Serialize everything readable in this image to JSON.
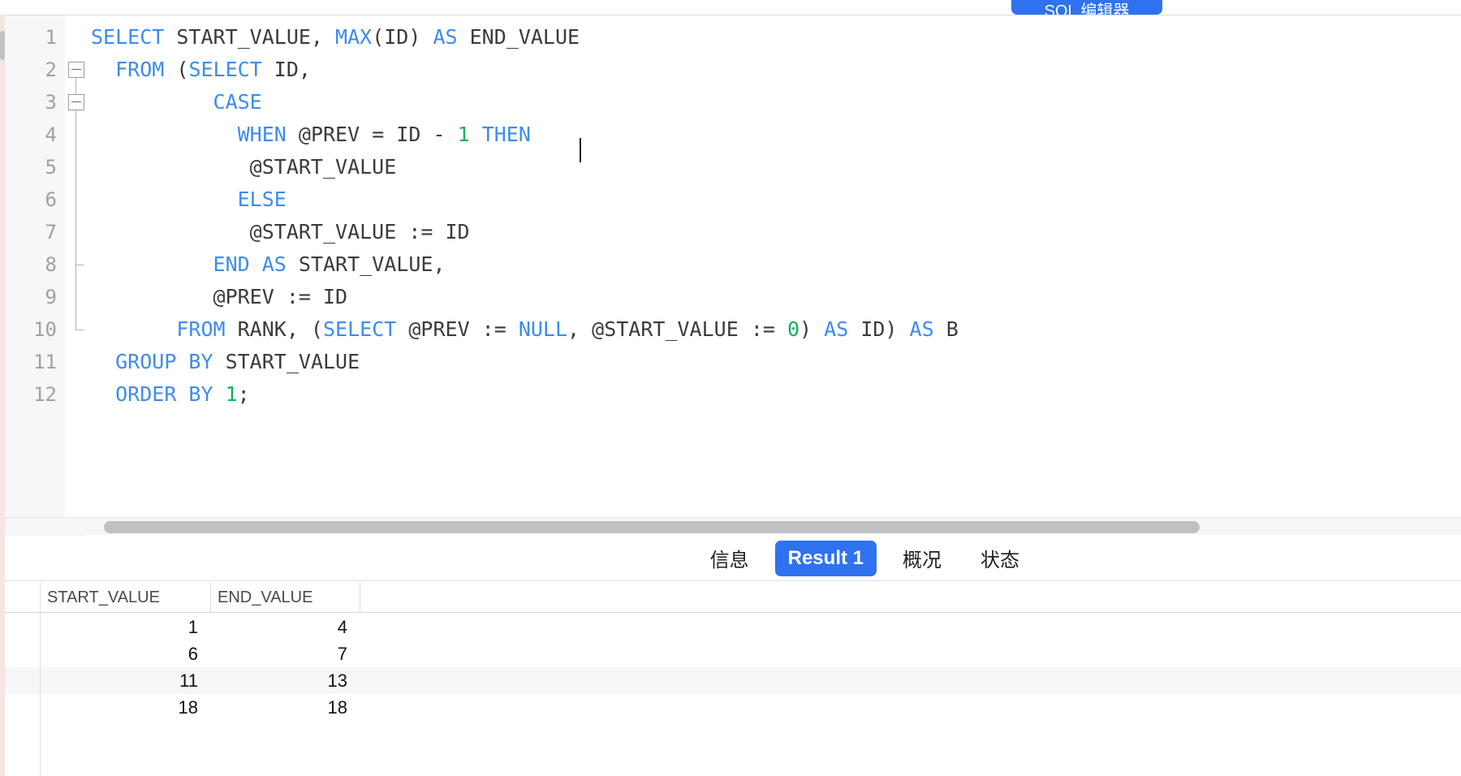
{
  "toolbar": {
    "sql_editor_button": "SQL 编辑器",
    "accent_color": "#2f72f0"
  },
  "editor": {
    "language": "sql",
    "caret_line": 4,
    "caret_after_text": "THEN",
    "lines": [
      {
        "n": "1",
        "tokens": [
          {
            "t": "SELECT",
            "c": "kw"
          },
          {
            "t": " START_VALUE, ",
            "c": "pl"
          },
          {
            "t": "MAX",
            "c": "kw"
          },
          {
            "t": "(ID) ",
            "c": "pl"
          },
          {
            "t": "AS",
            "c": "kw"
          },
          {
            "t": " END_VALUE",
            "c": "pl"
          }
        ]
      },
      {
        "n": "2",
        "tokens": [
          {
            "t": "  ",
            "c": "pl"
          },
          {
            "t": "FROM",
            "c": "kw"
          },
          {
            "t": " (",
            "c": "pl"
          },
          {
            "t": "SELECT",
            "c": "kw"
          },
          {
            "t": " ID,",
            "c": "pl"
          }
        ]
      },
      {
        "n": "3",
        "tokens": [
          {
            "t": "          ",
            "c": "pl"
          },
          {
            "t": "CASE",
            "c": "kw"
          }
        ]
      },
      {
        "n": "4",
        "tokens": [
          {
            "t": "            ",
            "c": "pl"
          },
          {
            "t": "WHEN",
            "c": "kw"
          },
          {
            "t": " @PREV = ID - ",
            "c": "pl"
          },
          {
            "t": "1",
            "c": "num"
          },
          {
            "t": " ",
            "c": "pl"
          },
          {
            "t": "THEN",
            "c": "kw"
          }
        ]
      },
      {
        "n": "5",
        "tokens": [
          {
            "t": "             @START_VALUE",
            "c": "pl"
          }
        ]
      },
      {
        "n": "6",
        "tokens": [
          {
            "t": "            ",
            "c": "pl"
          },
          {
            "t": "ELSE",
            "c": "kw"
          }
        ]
      },
      {
        "n": "7",
        "tokens": [
          {
            "t": "             @START_VALUE := ID",
            "c": "pl"
          }
        ]
      },
      {
        "n": "8",
        "tokens": [
          {
            "t": "          ",
            "c": "pl"
          },
          {
            "t": "END",
            "c": "kw"
          },
          {
            "t": " ",
            "c": "pl"
          },
          {
            "t": "AS",
            "c": "kw"
          },
          {
            "t": " START_VALUE,",
            "c": "pl"
          }
        ]
      },
      {
        "n": "9",
        "tokens": [
          {
            "t": "          @PREV := ID",
            "c": "pl"
          }
        ]
      },
      {
        "n": "10",
        "tokens": [
          {
            "t": "       ",
            "c": "pl"
          },
          {
            "t": "FROM",
            "c": "kw"
          },
          {
            "t": " RANK, (",
            "c": "pl"
          },
          {
            "t": "SELECT",
            "c": "kw"
          },
          {
            "t": " @PREV := ",
            "c": "pl"
          },
          {
            "t": "NULL",
            "c": "kw"
          },
          {
            "t": ", @START_VALUE := ",
            "c": "pl"
          },
          {
            "t": "0",
            "c": "num"
          },
          {
            "t": ") ",
            "c": "pl"
          },
          {
            "t": "AS",
            "c": "kw"
          },
          {
            "t": " ID) ",
            "c": "pl"
          },
          {
            "t": "AS",
            "c": "kw"
          },
          {
            "t": " B",
            "c": "pl"
          }
        ]
      },
      {
        "n": "11",
        "tokens": [
          {
            "t": "  ",
            "c": "pl"
          },
          {
            "t": "GROUP BY",
            "c": "kw"
          },
          {
            "t": " START_VALUE",
            "c": "pl"
          }
        ]
      },
      {
        "n": "12",
        "tokens": [
          {
            "t": "  ",
            "c": "pl"
          },
          {
            "t": "ORDER BY",
            "c": "kw"
          },
          {
            "t": " ",
            "c": "pl"
          },
          {
            "t": "1",
            "c": "num"
          },
          {
            "t": ";",
            "c": "pl"
          }
        ]
      }
    ],
    "fold_boxes": [
      2,
      3
    ],
    "fold_tick_line": 8,
    "fold_end_line": 10
  },
  "results": {
    "tabs": [
      {
        "label": "信息",
        "active": false
      },
      {
        "label": "Result 1",
        "active": true
      },
      {
        "label": "概况",
        "active": false
      },
      {
        "label": "状态",
        "active": false
      }
    ],
    "columns": [
      "START_VALUE",
      "END_VALUE"
    ],
    "rows": [
      {
        "start_value": "1",
        "end_value": "4"
      },
      {
        "start_value": "6",
        "end_value": "7"
      },
      {
        "start_value": "11",
        "end_value": "13"
      },
      {
        "start_value": "18",
        "end_value": "18"
      }
    ]
  }
}
